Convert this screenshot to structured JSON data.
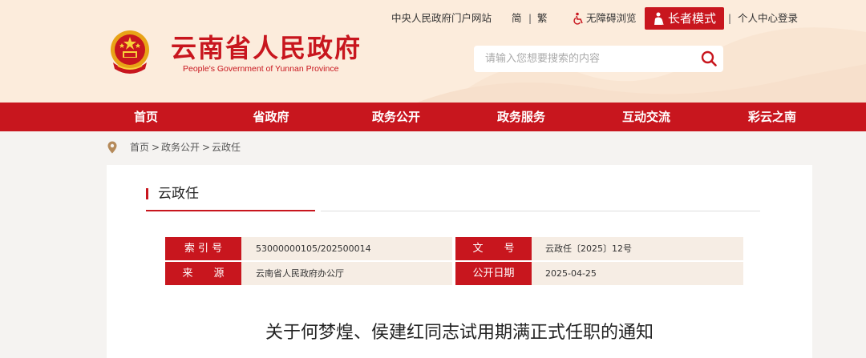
{
  "header": {
    "site_title": "云南省人民政府",
    "site_subtitle": "People's Government of Yunnan Province",
    "emblem_icon": "national-emblem-icon",
    "top_links": {
      "central_portal": "中央人民政府门户网站",
      "simplified": "简",
      "traditional": "繁",
      "accessible": "无障碍浏览",
      "elder_mode": "长者模式",
      "user_center": "个人中心登录"
    },
    "search": {
      "placeholder": "请输入您想要搜索的内容",
      "value": ""
    }
  },
  "nav": {
    "items": [
      "首页",
      "省政府",
      "政务公开",
      "政务服务",
      "互动交流",
      "彩云之南"
    ]
  },
  "breadcrumb": {
    "items": [
      "首页",
      "政务公开",
      "云政任"
    ],
    "separator": ">"
  },
  "section": {
    "title": "云政任"
  },
  "meta": {
    "index_label": "索 引 号",
    "index_value": "53000000105/202500014",
    "doc_no_label": "文　　号",
    "doc_no_value": "云政任〔2025〕12号",
    "source_label": "来　　源",
    "source_value": "云南省人民政府办公厅",
    "date_label": "公开日期",
    "date_value": "2025-04-25"
  },
  "document": {
    "title": "关于何梦煌、侯建红同志试用期满正式任职的通知"
  },
  "colors": {
    "brand_red": "#c8161e",
    "header_bg": "#fcecdc",
    "meta_bg": "#f6ede4"
  }
}
